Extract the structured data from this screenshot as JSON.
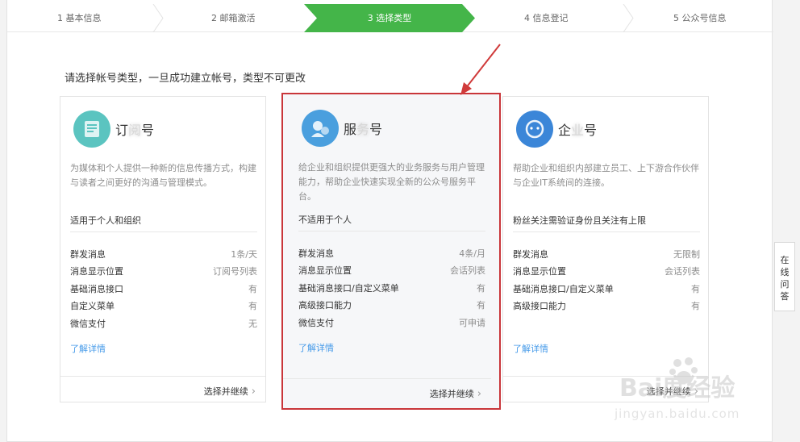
{
  "steps": [
    {
      "label": "1 基本信息"
    },
    {
      "label": "2 邮箱激活"
    },
    {
      "label": "3 选择类型"
    },
    {
      "label": "4 信息登记"
    },
    {
      "label": "5 公众号信息"
    }
  ],
  "page_title": "请选择帐号类型，一旦成功建立帐号，类型不可更改",
  "cards": [
    {
      "name_pre": "订",
      "name_blur": "阅",
      "name_post": "号",
      "icon": "subscription-icon",
      "icon_color": "#5bc4c0",
      "desc": "为媒体和个人提供一种新的信息传播方式，构建与读者之间更好的沟通与管理模式。",
      "fit": "适用于个人和组织",
      "features": [
        {
          "k": "群发消息",
          "v": "1条/天"
        },
        {
          "k": "消息显示位置",
          "v": "订阅号列表"
        },
        {
          "k": "基础消息接口",
          "v": "有"
        },
        {
          "k": "自定义菜单",
          "v": "有"
        },
        {
          "k": "微信支付",
          "v": "无"
        }
      ],
      "more": "了解详情",
      "select": "选择并继续"
    },
    {
      "name_pre": "服",
      "name_blur": "务",
      "name_post": "号",
      "icon": "service-icon",
      "icon_color": "#4a9fde",
      "desc": "给企业和组织提供更强大的业务服务与用户管理能力，帮助企业快速实现全新的公众号服务平台。",
      "fit": "不适用于个人",
      "features": [
        {
          "k": "群发消息",
          "v": "4条/月"
        },
        {
          "k": "消息显示位置",
          "v": "会话列表"
        },
        {
          "k": "基础消息接口/自定义菜单",
          "v": "有"
        },
        {
          "k": "高级接口能力",
          "v": "有"
        },
        {
          "k": "微信支付",
          "v": "可申请"
        }
      ],
      "more": "了解详情",
      "select": "选择并继续"
    },
    {
      "name_pre": "企",
      "name_blur": "业",
      "name_post": "号",
      "icon": "enterprise-icon",
      "icon_color": "#3b86d8",
      "desc": "帮助企业和组织内部建立员工、上下游合作伙伴与企业IT系统间的连接。",
      "fit": "粉丝关注需验证身份且关注有上限",
      "features": [
        {
          "k": "群发消息",
          "v": "无限制"
        },
        {
          "k": "消息显示位置",
          "v": "会话列表"
        },
        {
          "k": "基础消息接口/自定义菜单",
          "v": "有"
        },
        {
          "k": "高级接口能力",
          "v": "有"
        }
      ],
      "more": "了解详情",
      "select": "选择并继续"
    }
  ],
  "side_help": "在线问答",
  "watermark": {
    "main": "Bai度经验",
    "sub": "jingyan.baidu.com"
  },
  "colors": {
    "active_step": "#44b549",
    "highlight": "#c9363a",
    "link": "#459ae9"
  }
}
